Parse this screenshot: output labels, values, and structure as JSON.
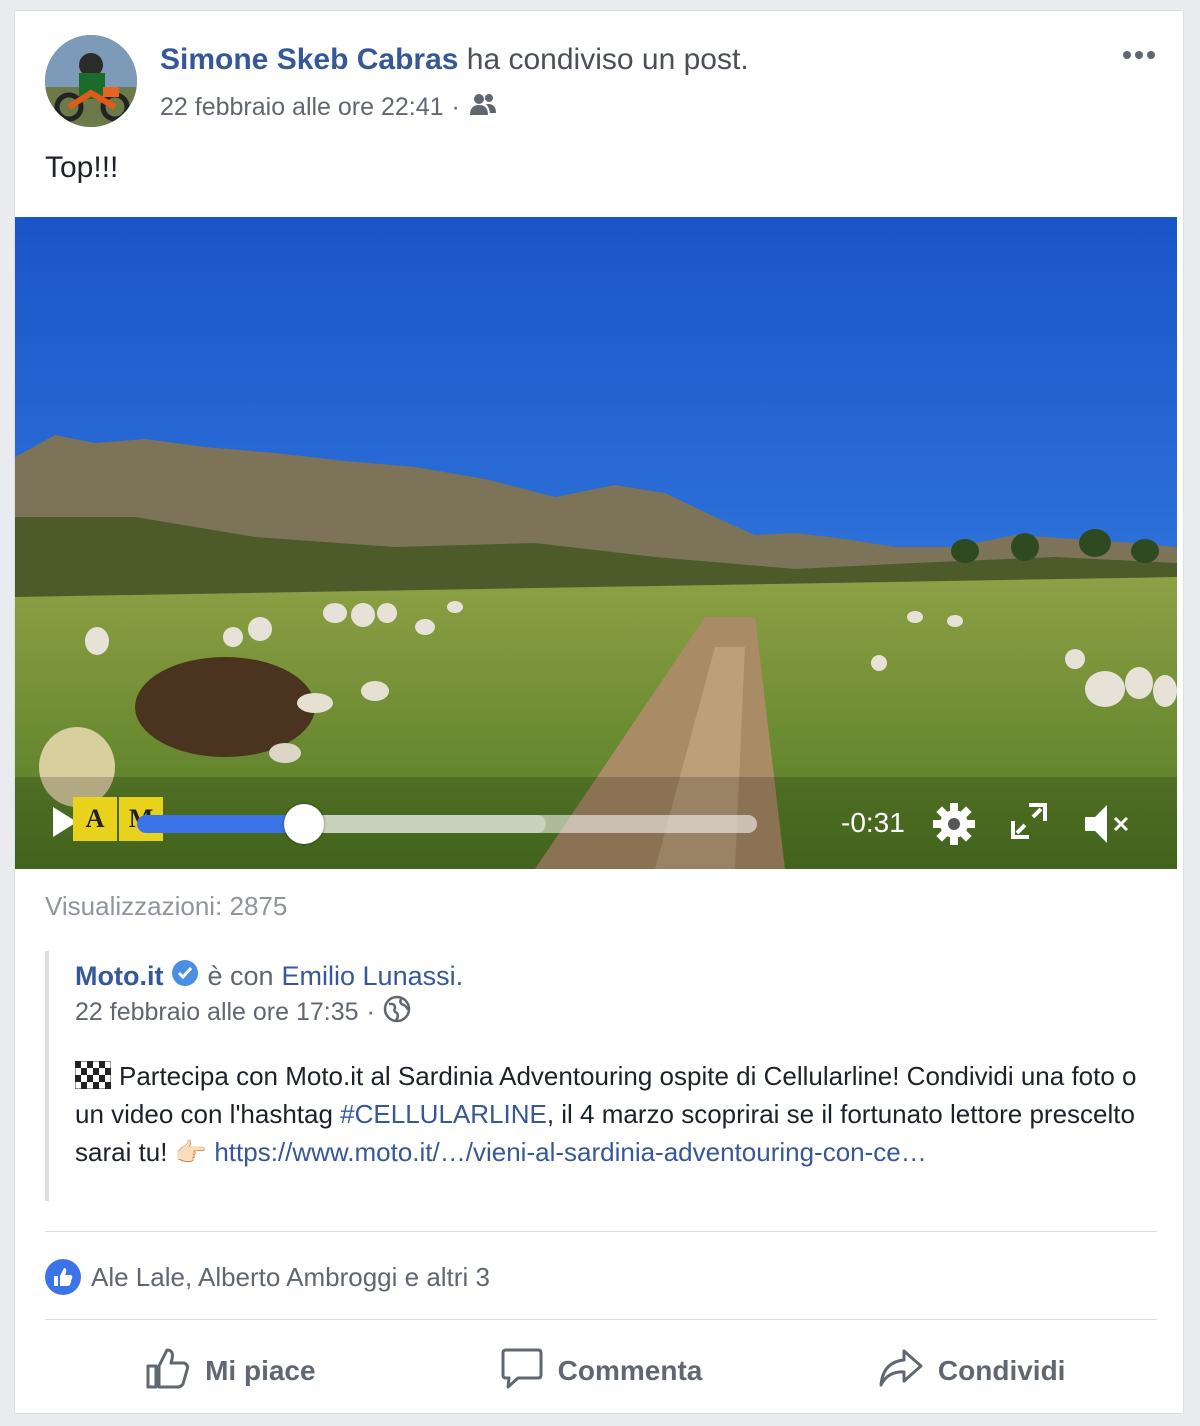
{
  "post": {
    "author": "Simone Skeb Cabras",
    "shared_text": "ha condiviso un post.",
    "timestamp": "22 febbraio alle ore 22:41",
    "meta_separator": "·",
    "audience_icon": "friends-icon",
    "more_icon": "more-options-icon",
    "text": "Top!!!"
  },
  "video": {
    "logo_letters": [
      "A",
      "M"
    ],
    "progress": 0.27,
    "buffered": 0.66,
    "time_remaining": "-0:31",
    "icons": [
      "play-icon",
      "settings-icon",
      "fullscreen-icon",
      "muted-icon"
    ]
  },
  "views": "Visualizzazioni: 2875",
  "shared_post": {
    "page": "Moto.it",
    "verified_icon": "verified-badge-icon",
    "with_text": "è con",
    "tagged": "Emilio Lunassi.",
    "timestamp": "22 febbraio alle ore 17:35",
    "meta_separator": "·",
    "audience_icon": "globe-icon",
    "text_part1": "Partecipa con Moto.it al Sardinia Adventouring ospite di Cellularline! Condividi una foto o un video con l'hashtag",
    "hashtag": "#CELLULARLINE",
    "text_part2": ", il 4 marzo scoprirai se il fortunato lettore prescelto sarai tu!",
    "emoji": "👉🏻",
    "link": "https://www.moto.it/…/vieni-al-sardinia-adventouring-con-ce…"
  },
  "reactions": {
    "text": "Ale Lale, Alberto Ambroggi e altri 3"
  },
  "actions": {
    "like": "Mi piace",
    "comment": "Commenta",
    "share": "Condividi"
  },
  "colors": {
    "link": "#365899",
    "accent": "#3b74e8",
    "background": "#e9ebee"
  }
}
